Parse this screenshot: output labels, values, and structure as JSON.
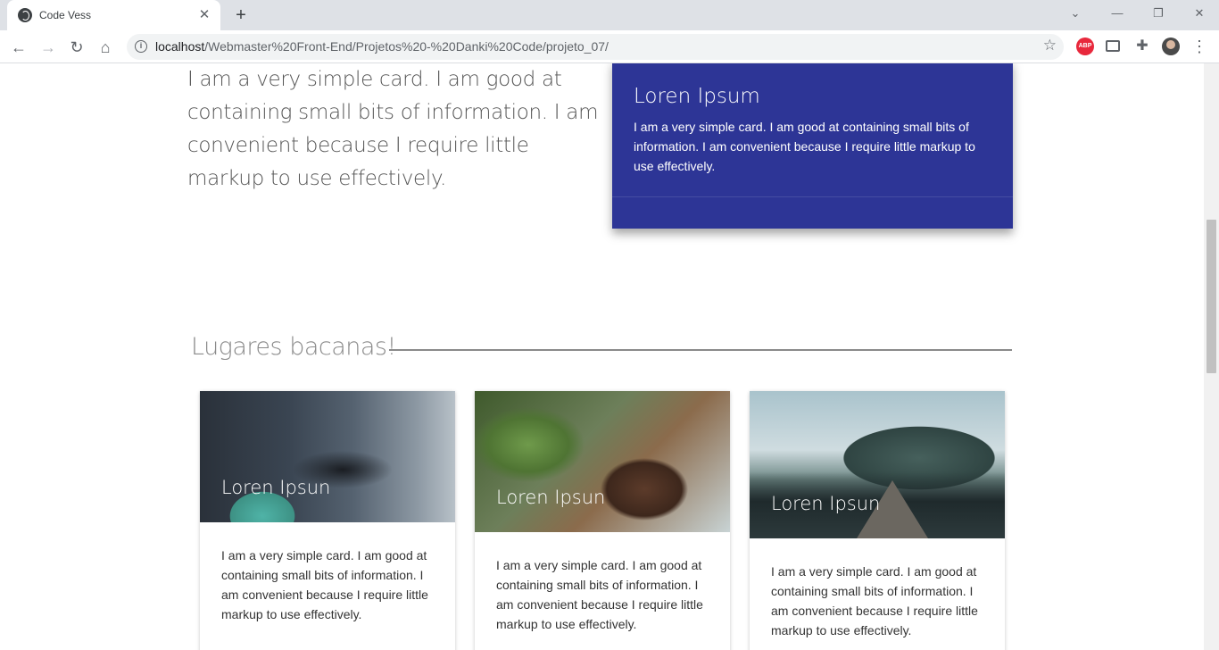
{
  "browser": {
    "tab_title": "Code Vess",
    "tab_close": "✕",
    "new_tab": "+",
    "url_host": "localhost",
    "url_path": "/Webmaster%20Front-End/Projetos%20-%20Danki%20Code/projeto_07/",
    "abp_label": "ABP"
  },
  "page": {
    "intro_text": "I am a very simple card. I am good at containing small bits of information. I am convenient because I require little markup to use effectively.",
    "blue_card": {
      "title": "Loren Ipsum",
      "text": "I am a very simple card. I am good at containing small bits of information. I am convenient because I require little markup to use effectively.",
      "color": "#2d3596"
    },
    "section_title": "Lugares bacanas!",
    "cards": [
      {
        "title": "Loren Ipsun",
        "text": "I am a very simple card. I am good at containing small bits of information. I am convenient because I require little markup to use effectively."
      },
      {
        "title": "Loren Ipsun",
        "text": "I am a very simple card. I am good at containing small bits of information. I am convenient because I require little markup to use effectively."
      },
      {
        "title": "Loren Ipsun",
        "text": "I am a very simple card. I am good at containing small bits of information. I am convenient because I require little markup to use effectively."
      }
    ]
  }
}
